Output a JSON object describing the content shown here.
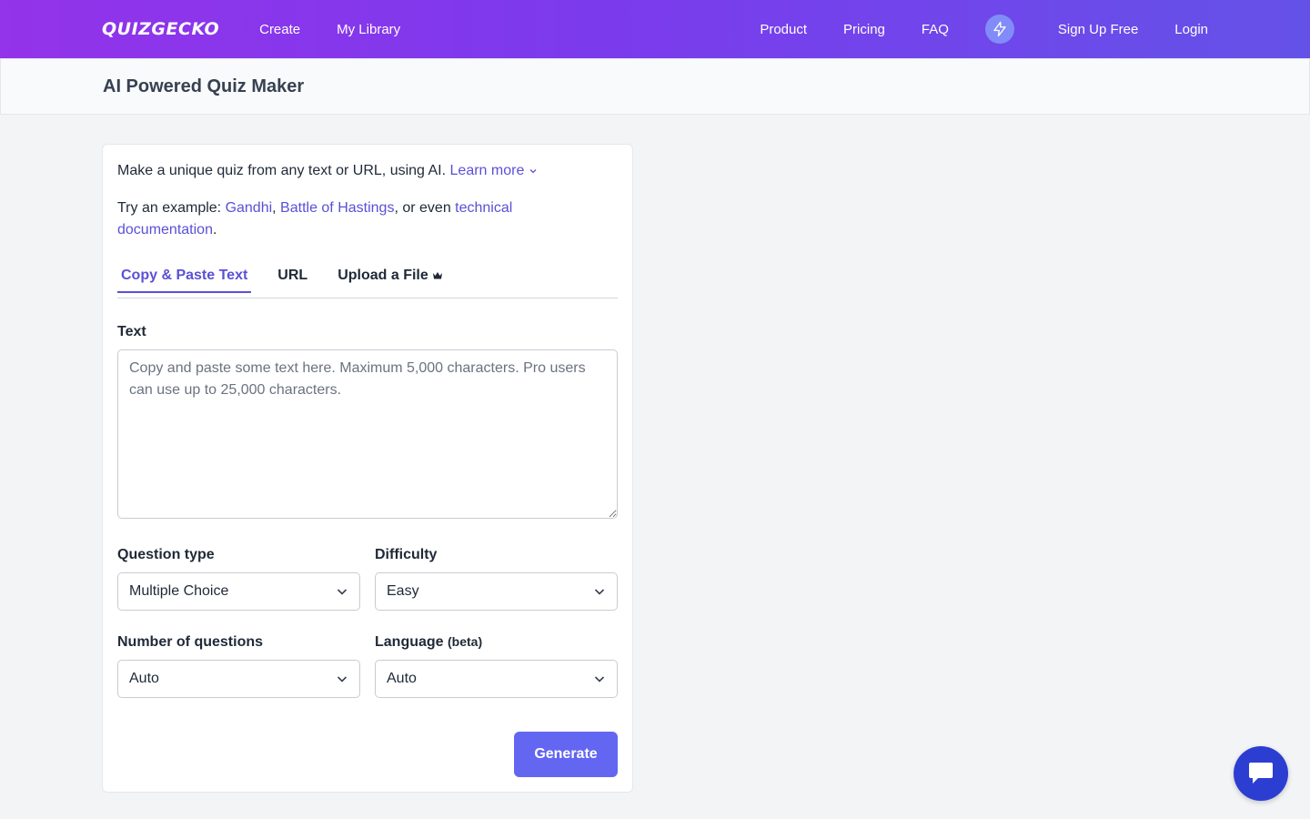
{
  "nav": {
    "brand": "QUIZGECKO",
    "left_links": [
      "Create",
      "My Library"
    ],
    "right_links": [
      "Product",
      "Pricing",
      "FAQ"
    ],
    "signup": "Sign Up Free",
    "login": "Login"
  },
  "header": {
    "title": "AI Powered Quiz Maker"
  },
  "intro": {
    "text": "Make a unique quiz from any text or URL, using AI. ",
    "learn_more": "Learn more"
  },
  "example": {
    "prefix": "Try an example: ",
    "link1": "Gandhi",
    "sep1": ", ",
    "link2": "Battle of Hastings",
    "sep2": ", or even ",
    "link3": "technical documentation",
    "suffix": "."
  },
  "tabs": [
    {
      "label": "Copy & Paste Text",
      "active": true
    },
    {
      "label": "URL",
      "active": false
    },
    {
      "label": "Upload a File",
      "active": false
    }
  ],
  "text_field": {
    "label": "Text",
    "placeholder": "Copy and paste some text here. Maximum 5,000 characters. Pro users can use up to 25,000 characters.",
    "value": ""
  },
  "question_type": {
    "label": "Question type",
    "value": "Multiple Choice"
  },
  "difficulty": {
    "label": "Difficulty",
    "value": "Easy"
  },
  "num_questions": {
    "label": "Number of questions",
    "value": "Auto"
  },
  "language": {
    "label": "Language",
    "label_suffix": "(beta)",
    "value": "Auto"
  },
  "generate_label": "Generate",
  "colors": {
    "accent": "#6366f1",
    "link": "#5b50d6",
    "chat": "#2c3ed2"
  }
}
